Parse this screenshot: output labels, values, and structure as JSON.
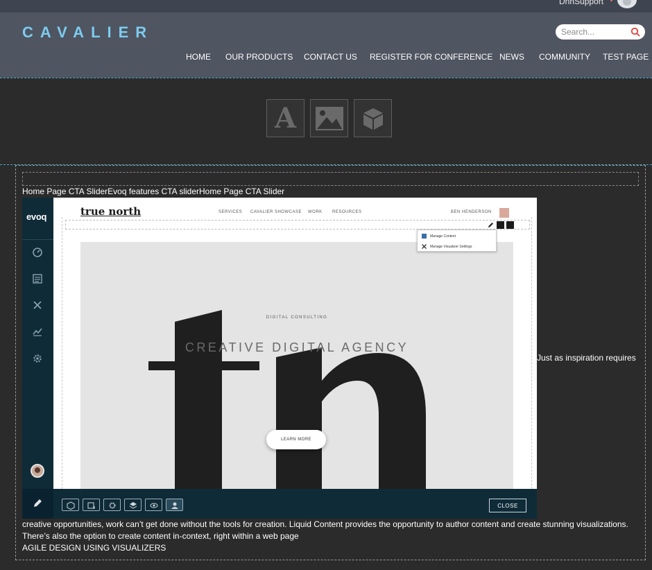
{
  "header": {
    "user_name": "DnnSupport",
    "logo_text": "CAVALIER",
    "search_placeholder": "Search...",
    "nav": [
      "HOME",
      "OUR PRODUCTS",
      "CONTACT US",
      "REGISTER FOR CONFERENCE",
      "NEWS",
      "COMMUNITY",
      "TEST PAGE"
    ]
  },
  "module_toolbar": {
    "text_module_glyph": "A",
    "icons": [
      "text-module-icon",
      "image-module-icon",
      "module-box-icon"
    ]
  },
  "content": {
    "cta_title": "Home Page CTA SliderEvoq features CTA sliderHome Page CTA Slider",
    "paragraph_start": "Just as inspiration requires",
    "paragraph_cont": "creative opportunities, work can’t get done without the tools for creation. Liquid Content provides the opportunity to author content and create stunning visualizations. There’s also the option to create content in-context, right within a web page",
    "heading": "AGILE DESIGN USING VISUALIZERS"
  },
  "screenshot": {
    "evoq_logo": "evoq",
    "site_logo": "true north",
    "site_nav": [
      "SERVICES",
      "CAVALIER SHOWCASE",
      "WORK",
      "RESOURCES"
    ],
    "site_user": "BEN HENDERSON",
    "menu": [
      "Manage Content",
      "Manage Visualizer Settings"
    ],
    "hero_subtitle": "DIGITAL CONSULTING",
    "hero_title": "CREATIVE DIGITAL AGENCY",
    "hero_button": "LEARN MORE",
    "close_label": "CLOSE"
  },
  "colors": {
    "header_bg": "#4f5561",
    "logo": "#7ecbef",
    "page_bg": "#2b2b2b",
    "evoq_bar": "#0f2b38"
  }
}
